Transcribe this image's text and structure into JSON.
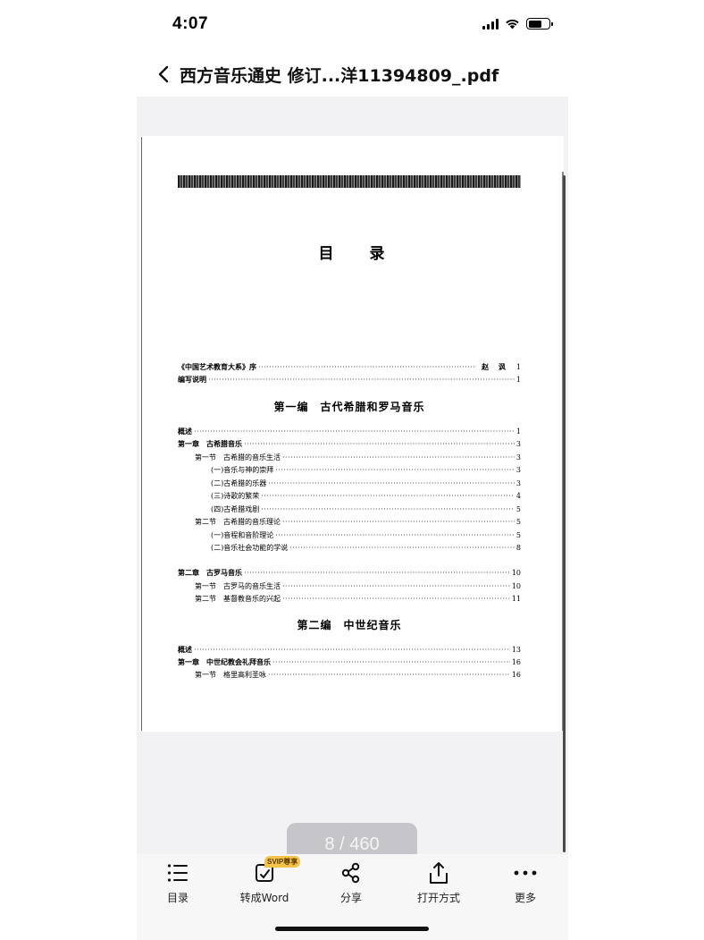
{
  "status_bar": {
    "time": "4:07"
  },
  "nav": {
    "title": "西方音乐通史 修订...洋11394809_.pdf"
  },
  "page": {
    "heading": "目录",
    "toc": [
      {
        "label": "《中国艺术教育大系》序",
        "author": "赵 沨",
        "page": "1",
        "bold": true,
        "indent": 0
      },
      {
        "label": "编写说明",
        "page": "1",
        "bold": true,
        "indent": 0
      }
    ],
    "part1": {
      "title": "第一编　古代希腊和罗马音乐",
      "entries": [
        {
          "label": "概述",
          "page": "1",
          "bold": true,
          "indent": 0
        },
        {
          "label": "第一章　古希腊音乐",
          "page": "3",
          "bold": true,
          "indent": 0
        },
        {
          "label": "第一节　古希腊的音乐生活",
          "page": "3",
          "bold": false,
          "indent": 1
        },
        {
          "label": "(一)音乐与神的崇拜",
          "page": "3",
          "bold": false,
          "indent": 2
        },
        {
          "label": "(二)古希腊的乐器",
          "page": "3",
          "bold": false,
          "indent": 2
        },
        {
          "label": "(三)诗歌的繁荣",
          "page": "4",
          "bold": false,
          "indent": 2
        },
        {
          "label": "(四)古希腊戏剧",
          "page": "5",
          "bold": false,
          "indent": 2
        },
        {
          "label": "第二节　古希腊的音乐理论",
          "page": "5",
          "bold": false,
          "indent": 1
        },
        {
          "label": "(一)音程和音阶理论",
          "page": "5",
          "bold": false,
          "indent": 2
        },
        {
          "label": "(二)音乐社会功能的学说",
          "page": "8",
          "bold": false,
          "indent": 2
        },
        {
          "label": "第二章　古罗马音乐",
          "page": "10",
          "bold": true,
          "indent": 0
        },
        {
          "label": "第一节　古罗马的音乐生活",
          "page": "10",
          "bold": false,
          "indent": 1
        },
        {
          "label": "第二节　基督教音乐的兴起",
          "page": "11",
          "bold": false,
          "indent": 1
        }
      ]
    },
    "part2": {
      "title": "第二编　中世纪音乐",
      "entries": [
        {
          "label": "概述",
          "page": "13",
          "bold": true,
          "indent": 0
        },
        {
          "label": "第一章　中世纪教会礼拜音乐",
          "page": "16",
          "bold": true,
          "indent": 0
        },
        {
          "label": "第一节　格里高利圣咏",
          "page": "16",
          "bold": false,
          "indent": 1
        }
      ]
    }
  },
  "page_indicator": {
    "current": "8",
    "separator": "/",
    "total": "460",
    "text": "8 / 460"
  },
  "tab_bar": {
    "items": [
      {
        "label": "目录",
        "icon": "list-icon"
      },
      {
        "label": "转成Word",
        "icon": "convert-word-icon",
        "badge": "SVIP尊享"
      },
      {
        "label": "分享",
        "icon": "share-icon"
      },
      {
        "label": "打开方式",
        "icon": "open-with-icon"
      },
      {
        "label": "更多",
        "icon": "more-icon"
      }
    ]
  },
  "colors": {
    "viewer_bg": "#f2f2f4",
    "badge": "#f5c24a",
    "indicator_bg": "#c6c6ca"
  }
}
